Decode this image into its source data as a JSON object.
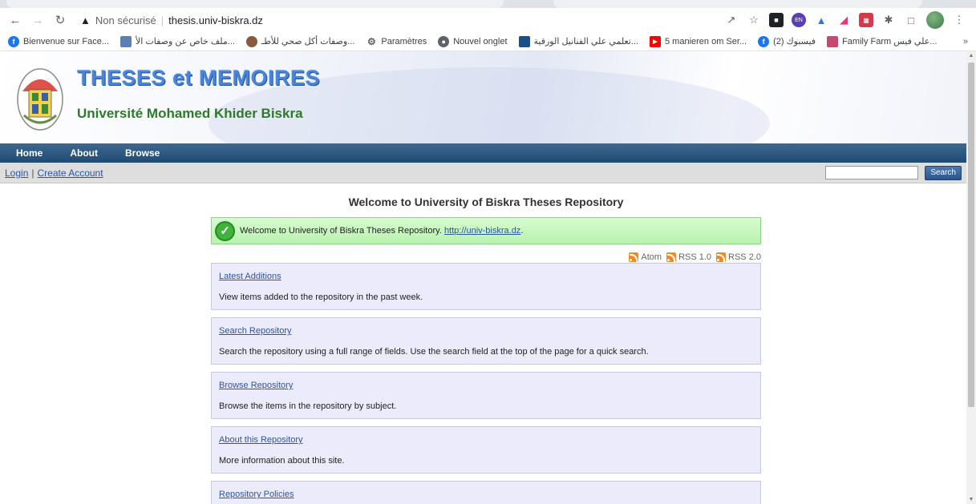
{
  "browser": {
    "security_label": "Non sécurisé",
    "url": "thesis.univ-biskra.dz"
  },
  "bookmarks": [
    {
      "label": "Bienvenue sur Face...",
      "icon": "facebook-icon",
      "color": "#1877f2"
    },
    {
      "label": "ملف خاص عن وصفات الأ...",
      "icon": "bookmark-favicon",
      "color": "#5b7fb0"
    },
    {
      "label": "وصفات أكل صحي للأطـ...",
      "icon": "bookmark-favicon",
      "color": "#8a5a3c"
    },
    {
      "label": "Paramètres",
      "icon": "gear-icon",
      "color": "#5f6368"
    },
    {
      "label": "Nouvel onglet",
      "icon": "chrome-icon",
      "color": "#5f6368"
    },
    {
      "label": "تعلمي علي الفنانيل الورقية...",
      "icon": "bookmark-favicon",
      "color": "#1a4f8a"
    },
    {
      "label": "5 manieren om Ser...",
      "icon": "youtube-icon",
      "color": "#ff0000"
    },
    {
      "label": "(2) فيسبوك",
      "icon": "facebook-icon",
      "color": "#1877f2"
    },
    {
      "label": "Family Farm علي فيس...",
      "icon": "bookmark-favicon",
      "color": "#c44b6e"
    }
  ],
  "site": {
    "title": "THESES et MEMOIRES",
    "subtitle": "Université Mohamed Khider Biskra"
  },
  "menu": [
    "Home",
    "About",
    "Browse"
  ],
  "account": {
    "login": "Login",
    "create": "Create Account",
    "search_button": "Search",
    "search_value": ""
  },
  "main": {
    "heading": "Welcome to University of Biskra Theses Repository",
    "notice_text": "Welcome to University of Biskra Theses Repository.",
    "notice_link": "http://univ-biskra.dz",
    "notice_end": ".",
    "feeds": [
      "Atom",
      "RSS 1.0",
      "RSS 2.0"
    ],
    "boxes": [
      {
        "link": "Latest Additions",
        "desc": "View items added to the repository in the past week."
      },
      {
        "link": "Search Repository",
        "desc": "Search the repository using a full range of fields. Use the search field at the top of the page for a quick search."
      },
      {
        "link": "Browse Repository",
        "desc": "Browse the items in the repository by subject."
      },
      {
        "link": "About this Repository",
        "desc": "More information about this site."
      },
      {
        "link": "Repository Policies",
        "desc": ""
      }
    ]
  },
  "colors": {
    "menu_bar": "#2a5580",
    "notice_bg": "#c8f7bd",
    "box_bg": "#ecebfb",
    "link": "#2b55a0"
  }
}
